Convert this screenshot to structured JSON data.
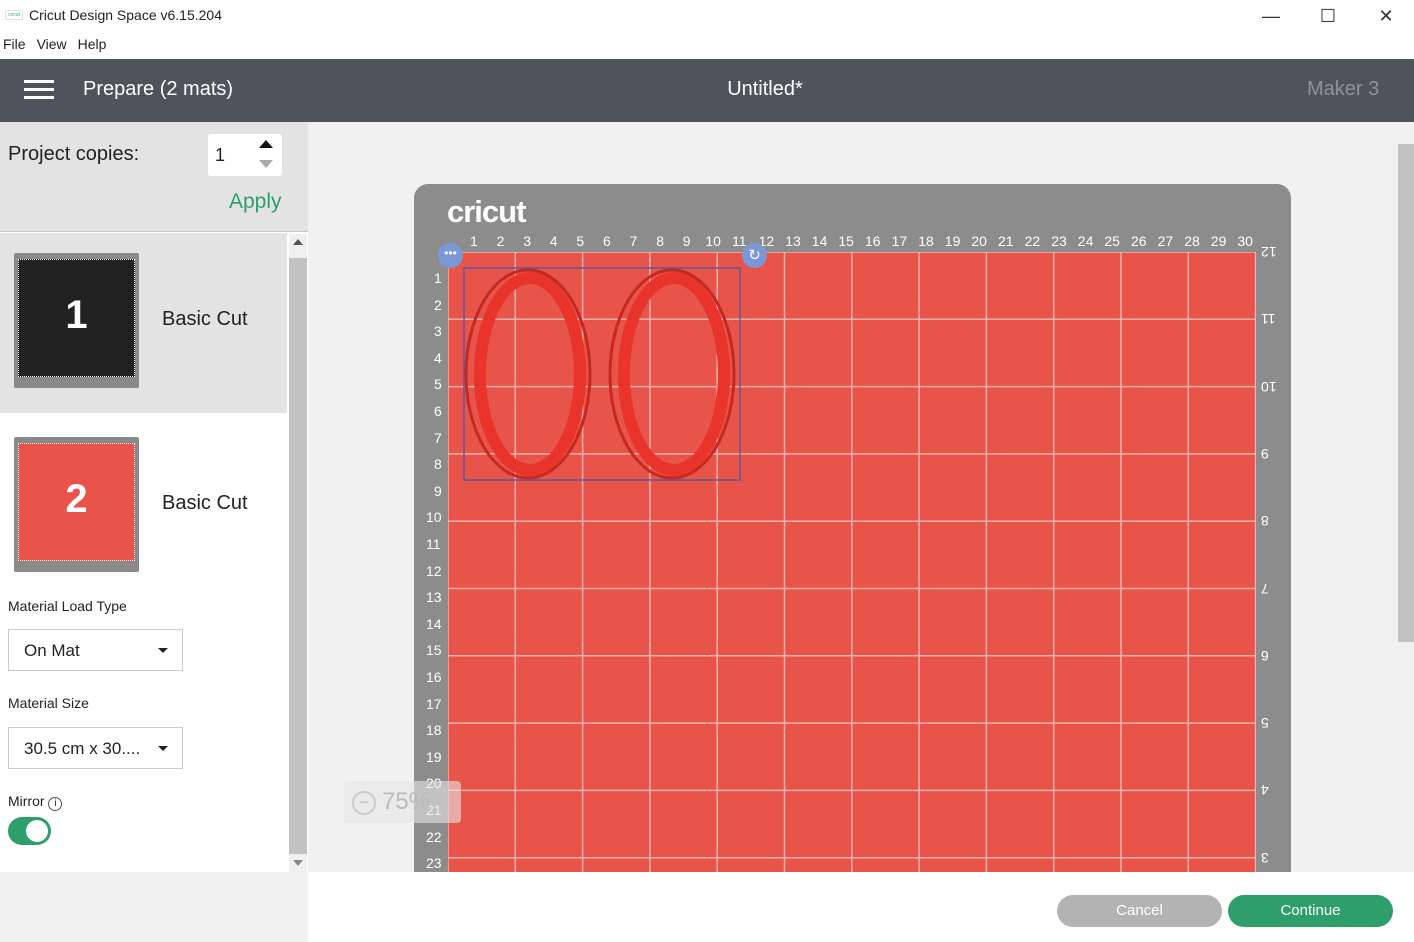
{
  "window": {
    "title": "Cricut Design Space  v6.15.204",
    "logo": "cricut",
    "controls": [
      "minimize-icon",
      "maximize-icon",
      "close-icon"
    ]
  },
  "menu": [
    "File",
    "View",
    "Help"
  ],
  "header": {
    "title": "Prepare (2 mats)",
    "project": "Untitled*",
    "machine": "Maker 3"
  },
  "copies": {
    "label": "Project copies:",
    "value": "1",
    "apply": "Apply"
  },
  "mats": [
    {
      "number": "1",
      "label": "Basic Cut",
      "selected": true
    },
    {
      "number": "2",
      "label": "Basic Cut",
      "selected": false
    }
  ],
  "material_load": {
    "label": "Material Load Type",
    "value": "On Mat"
  },
  "material_size": {
    "label": "Material Size",
    "value": "30.5 cm x 30...."
  },
  "mirror": {
    "label": "Mirror",
    "on": true
  },
  "mat_preview": {
    "brand": "cricut",
    "top_ruler": [
      "1",
      "2",
      "3",
      "4",
      "5",
      "6",
      "7",
      "8",
      "9",
      "10",
      "11",
      "12",
      "13",
      "14",
      "15",
      "16",
      "17",
      "18",
      "19",
      "20",
      "21",
      "22",
      "23",
      "24",
      "25",
      "26",
      "27",
      "28",
      "29",
      "30"
    ],
    "left_ruler": [
      "1",
      "2",
      "3",
      "4",
      "5",
      "6",
      "7",
      "8",
      "9",
      "10",
      "11",
      "12",
      "13",
      "14",
      "15",
      "16",
      "17",
      "18",
      "19",
      "20",
      "21",
      "22",
      "23"
    ],
    "right_ruler": [
      "12",
      "11",
      "10",
      "9",
      "8",
      "7",
      "6",
      "5",
      "4",
      "3"
    ],
    "mat_color": "#e8534a"
  },
  "zoom": {
    "value": "75%"
  },
  "buttons": {
    "cancel": "Cancel",
    "continue": "Continue"
  },
  "colors": {
    "accent": "#2e9e6b",
    "header": "#4f545c"
  }
}
